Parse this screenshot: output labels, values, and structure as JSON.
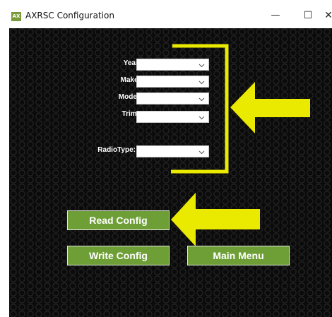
{
  "window": {
    "title": "AXRSC Configuration",
    "icon_text": "AX",
    "minimize_glyph": "—",
    "maximize_glyph": "☐",
    "close_glyph": "✕"
  },
  "form": {
    "year_label": "Year :",
    "make_label": "Make:",
    "model_label": "Model:",
    "trim_label": "Trim:",
    "radiotype_label": "RadioType:",
    "year_value": "",
    "make_value": "",
    "model_value": "",
    "trim_value": "",
    "radiotype_value": ""
  },
  "buttons": {
    "read_config": "Read Config",
    "write_config": "Write Config",
    "main_menu": "Main Menu"
  },
  "colors": {
    "button_green": "#6e9f36",
    "annotation_yellow": "#eaea00",
    "background": "#0b0b0b"
  },
  "icons": {
    "dropdown": "chevron-down-icon",
    "annotation_arrow": "arrow-left-icon",
    "annotation_bracket": "bracket-icon"
  }
}
